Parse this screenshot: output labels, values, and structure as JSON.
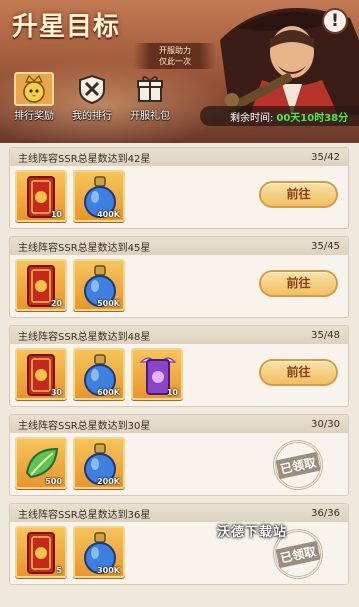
{
  "header": {
    "title": "升星目标",
    "promo_line1": "开服助力",
    "promo_line2": "仅此一次",
    "help_label": "!",
    "time_label": "剩余时间:",
    "time_value": "00天10时38分"
  },
  "tabs": [
    {
      "label": "排行奖励",
      "icon": "crown-chick-icon",
      "active": true
    },
    {
      "label": "我的排行",
      "icon": "crossed-swords-icon",
      "active": false
    },
    {
      "label": "开服礼包",
      "icon": "gift-box-icon",
      "active": false
    }
  ],
  "tasks": [
    {
      "title": "主线阵容SSR总星数达到42星",
      "progress": "35/42",
      "rewards": [
        {
          "icon": "red-card-icon",
          "qty": "10"
        },
        {
          "icon": "blue-potion-icon",
          "qty": "400K"
        }
      ],
      "action": "前往",
      "claimed": false
    },
    {
      "title": "主线阵容SSR总星数达到45星",
      "progress": "35/45",
      "rewards": [
        {
          "icon": "red-card-icon",
          "qty": "20"
        },
        {
          "icon": "blue-potion-icon",
          "qty": "500K"
        }
      ],
      "action": "前往",
      "claimed": false
    },
    {
      "title": "主线阵容SSR总星数达到48星",
      "progress": "35/48",
      "rewards": [
        {
          "icon": "red-card-icon",
          "qty": "30"
        },
        {
          "icon": "blue-potion-icon",
          "qty": "600K"
        },
        {
          "icon": "purple-winged-card-icon",
          "qty": "10"
        }
      ],
      "action": "前往",
      "claimed": false
    },
    {
      "title": "主线阵容SSR总星数达到30星",
      "progress": "30/30",
      "rewards": [
        {
          "icon": "green-leaf-icon",
          "qty": "500"
        },
        {
          "icon": "blue-potion-icon",
          "qty": "200K"
        }
      ],
      "action": "已领取",
      "claimed": true
    },
    {
      "title": "主线阵容SSR总星数达到36星",
      "progress": "36/36",
      "rewards": [
        {
          "icon": "red-card-icon",
          "qty": "5"
        },
        {
          "icon": "blue-potion-icon",
          "qty": "300K"
        }
      ],
      "action": "已领取",
      "claimed": true
    }
  ],
  "watermark": "沃德下载站",
  "colors": {
    "accent": "#f1bf63",
    "timer": "#4be84a",
    "banner": "#a9623f"
  }
}
